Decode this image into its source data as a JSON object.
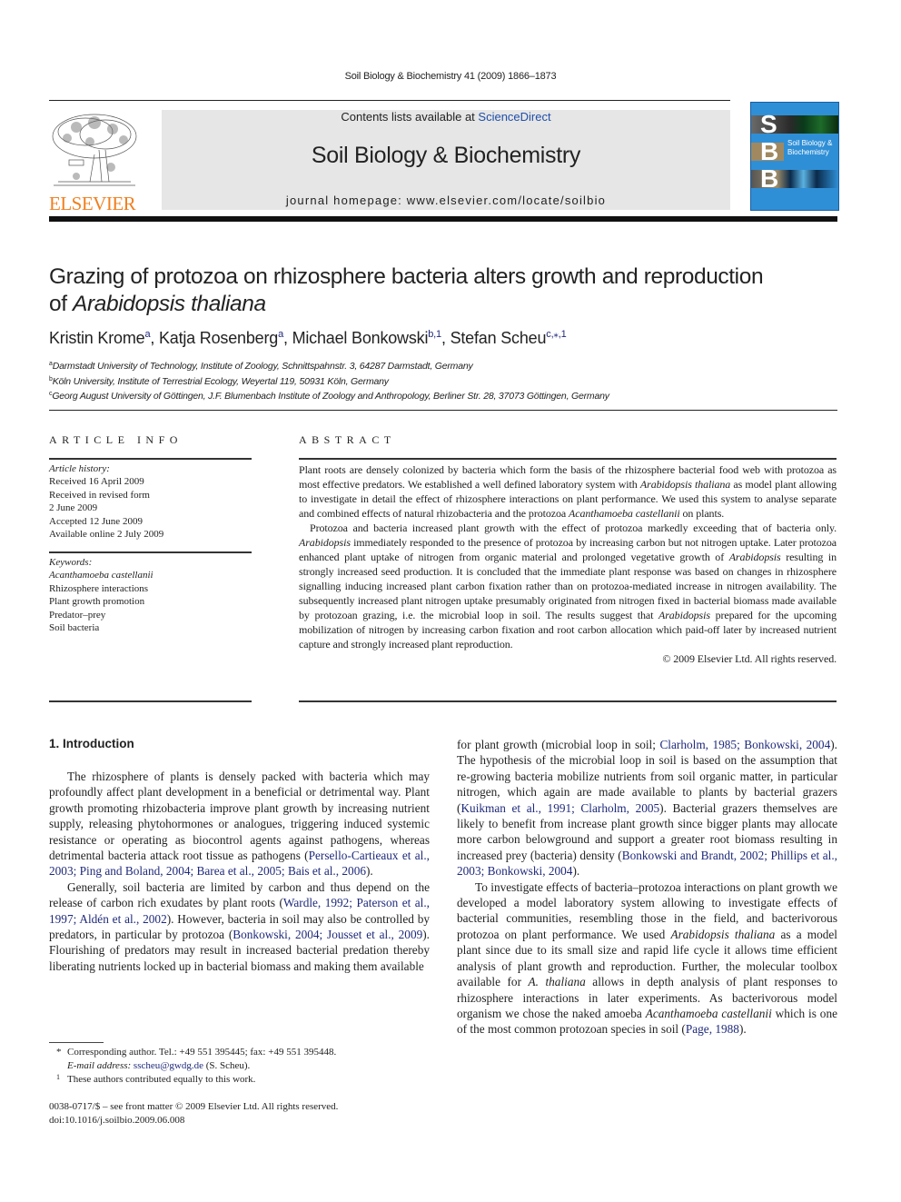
{
  "running_head": "Soil Biology & Biochemistry 41 (2009) 1866–1873",
  "banner": {
    "contents_prefix": "Contents lists available at ",
    "contents_link": "ScienceDirect",
    "journal_title": "Soil Biology & Biochemistry",
    "homepage": "journal homepage: www.elsevier.com/locate/soilbio"
  },
  "publisher_logo": {
    "icon": "elsevier-tree-icon",
    "wordmark": "ELSEVIER",
    "color": "#f07f1e"
  },
  "cover": {
    "icon": "journal-cover-icon",
    "letters": [
      "S",
      "B",
      "B"
    ],
    "title_lines": [
      "Soil Biology &",
      "Biochemistry"
    ],
    "color": "#2f8fd6"
  },
  "article": {
    "title_line1": "Grazing of protozoa on rhizosphere bacteria alters growth and reproduction",
    "title_line2_prefix": "of ",
    "title_line2_italic": "Arabidopsis thaliana",
    "authors": [
      {
        "name": "Kristin Krome",
        "sup": "a"
      },
      {
        "name": "Katja Rosenberg",
        "sup": "a"
      },
      {
        "name": "Michael Bonkowski",
        "sup": "b,1"
      },
      {
        "name": "Stefan Scheu",
        "sup": "c,⁎,1"
      }
    ],
    "affiliations": [
      {
        "mark": "a",
        "text": "Darmstadt University of Technology, Institute of Zoology, Schnittspahnstr. 3, 64287 Darmstadt, Germany"
      },
      {
        "mark": "b",
        "text": "Köln University, Institute of Terrestrial Ecology, Weyertal 119, 50931 Köln, Germany"
      },
      {
        "mark": "c",
        "text": "Georg August University of Göttingen, J.F. Blumenbach Institute of Zoology and Anthropology, Berliner Str. 28, 37073 Göttingen, Germany"
      }
    ]
  },
  "article_info": {
    "heading": "ARTICLE INFO",
    "history_label": "Article history:",
    "history": [
      "Received 16 April 2009",
      "Received in revised form",
      "2 June 2009",
      "Accepted 12 June 2009",
      "Available online 2 July 2009"
    ],
    "keywords_label": "Keywords:",
    "keywords": [
      "Acanthamoeba castellanii",
      "Rhizosphere interactions",
      "Plant growth promotion",
      "Predator–prey",
      "Soil bacteria"
    ]
  },
  "abstract": {
    "heading": "ABSTRACT",
    "p1": [
      {
        "t": "Plant roots are densely colonized by bacteria which form the basis of the rhizosphere bacterial food web with protozoa as most effective predators. We established a well defined laboratory system with "
      },
      {
        "i": "Arabidopsis thaliana"
      },
      {
        "t": " as model plant allowing to investigate in detail the effect of rhizosphere interactions on plant performance. We used this system to analyse separate and combined effects of natural rhizobacteria and the protozoa "
      },
      {
        "i": "Acanthamoeba castellanii"
      },
      {
        "t": " on plants."
      }
    ],
    "p2": [
      {
        "t": "Protozoa and bacteria increased plant growth with the effect of protozoa markedly exceeding that of bacteria only. "
      },
      {
        "i": "Arabidopsis"
      },
      {
        "t": " immediately responded to the presence of protozoa by increasing carbon but not nitrogen uptake. Later protozoa enhanced plant uptake of nitrogen from organic material and prolonged vegetative growth of "
      },
      {
        "i": "Arabidopsis"
      },
      {
        "t": " resulting in strongly increased seed production. It is concluded that the immediate plant response was based on changes in rhizosphere signalling inducing increased plant carbon fixation rather than on protozoa-mediated increase in nitrogen availability. The subsequently increased plant nitrogen uptake presumably originated from nitrogen fixed in bacterial biomass made available by protozoan grazing, i.e. the microbial loop in soil. The results suggest that "
      },
      {
        "i": "Arabidopsis"
      },
      {
        "t": " prepared for the upcoming mobilization of nitrogen by increasing carbon fixation and root carbon allocation which paid-off later by increased nutrient capture and strongly increased plant reproduction."
      }
    ],
    "copyright": "© 2009 Elsevier Ltd. All rights reserved."
  },
  "introduction": {
    "heading": "1.  Introduction",
    "p1": [
      {
        "t": "The rhizosphere of plants is densely packed with bacteria which may profoundly affect plant development in a beneficial or detrimental way. Plant growth promoting rhizobacteria improve plant growth by increasing nutrient supply, releasing phytohormones or analogues, triggering induced systemic resistance or operating as biocontrol agents against pathogens, whereas detrimental bacteria attack root tissue as pathogens ("
      },
      {
        "c": "Persello-Cartieaux et al., 2003; Ping and Boland, 2004; Barea et al., 2005; Bais et al., 2006"
      },
      {
        "t": ")."
      }
    ],
    "p2": [
      {
        "t": "Generally, soil bacteria are limited by carbon and thus depend on the release of carbon rich exudates by plant roots ("
      },
      {
        "c": "Wardle, 1992; Paterson et al., 1997; Aldén et al., 2002"
      },
      {
        "t": "). However, bacteria in soil may also be controlled by predators, in particular by protozoa ("
      },
      {
        "c": "Bonkowski, 2004; Jousset et al., 2009"
      },
      {
        "t": "). Flourishing of predators may result in increased bacterial predation thereby liberating nutrients locked up in bacterial biomass and making them available for plant growth (microbial loop in soil; "
      },
      {
        "c": "Clarholm, 1985; Bonkowski, 2004"
      },
      {
        "t": "). The hypothesis of the microbial loop in soil is based on the assumption that re-growing bacteria mobilize nutrients from soil organic matter, in particular nitrogen, which again are made available to plants by bacterial grazers ("
      },
      {
        "c": "Kuikman et al., 1991; Clarholm, 2005"
      },
      {
        "t": "). Bacterial grazers themselves are likely to benefit from increase plant growth since bigger plants may allocate more carbon belowground and support a greater root biomass resulting in increased prey (bacteria) density ("
      },
      {
        "c": "Bonkowski and Brandt, 2002; Phillips et al., 2003; Bonkowski, 2004"
      },
      {
        "t": ")."
      }
    ],
    "p3": [
      {
        "t": "To investigate effects of bacteria–protozoa interactions on plant growth we developed a model laboratory system allowing to investigate effects of bacterial communities, resembling those in the field, and bacterivorous protozoa on plant performance. We used "
      },
      {
        "i": "Arabidopsis thaliana"
      },
      {
        "t": " as a model plant since due to its small size and rapid life cycle it allows time efficient analysis of plant growth and reproduction. Further, the molecular toolbox available for "
      },
      {
        "i": "A. thaliana"
      },
      {
        "t": " allows in depth analysis of plant responses to rhizosphere interactions in later experiments. As bacterivorous model organism we chose the naked amoeba "
      },
      {
        "i": "Acanthamoeba castellanii"
      },
      {
        "t": " which is one of the most common protozoan species in soil ("
      },
      {
        "c": "Page, 1988"
      },
      {
        "t": ")."
      }
    ]
  },
  "footnotes": {
    "corr_mark": "*",
    "corr_text": "Corresponding author. Tel.: +49 551 395445; fax: +49 551 395448.",
    "email_label": "E-mail address: ",
    "email": "sscheu@gwdg.de",
    "email_suffix": " (S. Scheu).",
    "equal_mark": "1",
    "equal_text": "These authors contributed equally to this work."
  },
  "imprint": {
    "issn_line": "0038-0717/$ – see front matter © 2009 Elsevier Ltd. All rights reserved.",
    "doi": "doi:10.1016/j.soilbio.2009.06.008"
  }
}
